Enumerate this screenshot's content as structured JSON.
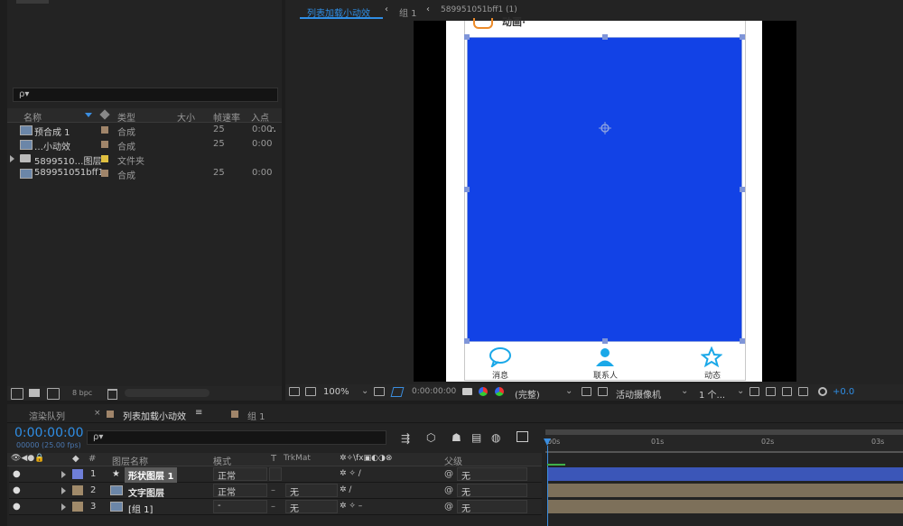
{
  "project": {
    "search_placeholder": "ρ▾",
    "columns": {
      "name": "名称",
      "type": "类型",
      "size": "大小",
      "fps": "帧速率",
      "in": "入点"
    },
    "items": [
      {
        "name": "预合成 1",
        "type": "合成",
        "fps": "25",
        "in": "0:00",
        "color": "#a0856a"
      },
      {
        "name": "…小动效",
        "type": "合成",
        "fps": "25",
        "in": "0:00",
        "color": "#a0856a"
      },
      {
        "name": "589951​0…图层",
        "type": "文件夹",
        "fps": "",
        "in": "",
        "color": "#e0c040"
      },
      {
        "name": "589951051bff1",
        "type": "合成",
        "fps": "25",
        "in": "0:00",
        "color": "#a0856a"
      }
    ],
    "bpc": "8 bpc"
  },
  "viewer": {
    "breadcrumb": [
      "列表加载小动效",
      "组 1",
      "589951051bff1 (1)"
    ],
    "phone": {
      "header_text": "动画·",
      "nav": [
        "消息",
        "联系人",
        "动态"
      ],
      "shape_color": "#1242e6"
    },
    "toolbar": {
      "zoom": "100%",
      "timecode": "0:00:00:00",
      "resolution": "(完整)",
      "camera": "活动摄像机",
      "views": "1 个...",
      "exposure": "+0.0"
    }
  },
  "timeline": {
    "tabs": {
      "render": "渲染队列",
      "comp": "列表加载小动效",
      "group": "组 1"
    },
    "timecode": "0:00:00:00",
    "fps_label": "00000 (25.00 fps)",
    "search_placeholder": "ρ▾",
    "columns": {
      "hash": "#",
      "layer_name": "图层名称",
      "mode": "模式",
      "t": "T",
      "trkmat": "TrkMat",
      "parent": "父级"
    },
    "ruler": [
      "00s",
      "01s",
      "02s",
      "03s"
    ],
    "layers": [
      {
        "num": "1",
        "name": "形状图层 1",
        "mode": "正常",
        "trkmat": "",
        "parent": "无",
        "color": "#6f7fd8"
      },
      {
        "num": "2",
        "name": "文字图层",
        "mode": "正常",
        "trkmat": "无",
        "parent": "无",
        "color": "#a08a6a"
      },
      {
        "num": "3",
        "name": "[组 1]",
        "mode": "-",
        "trkmat": "无",
        "parent": "无",
        "color": "#a08a6a"
      }
    ]
  }
}
